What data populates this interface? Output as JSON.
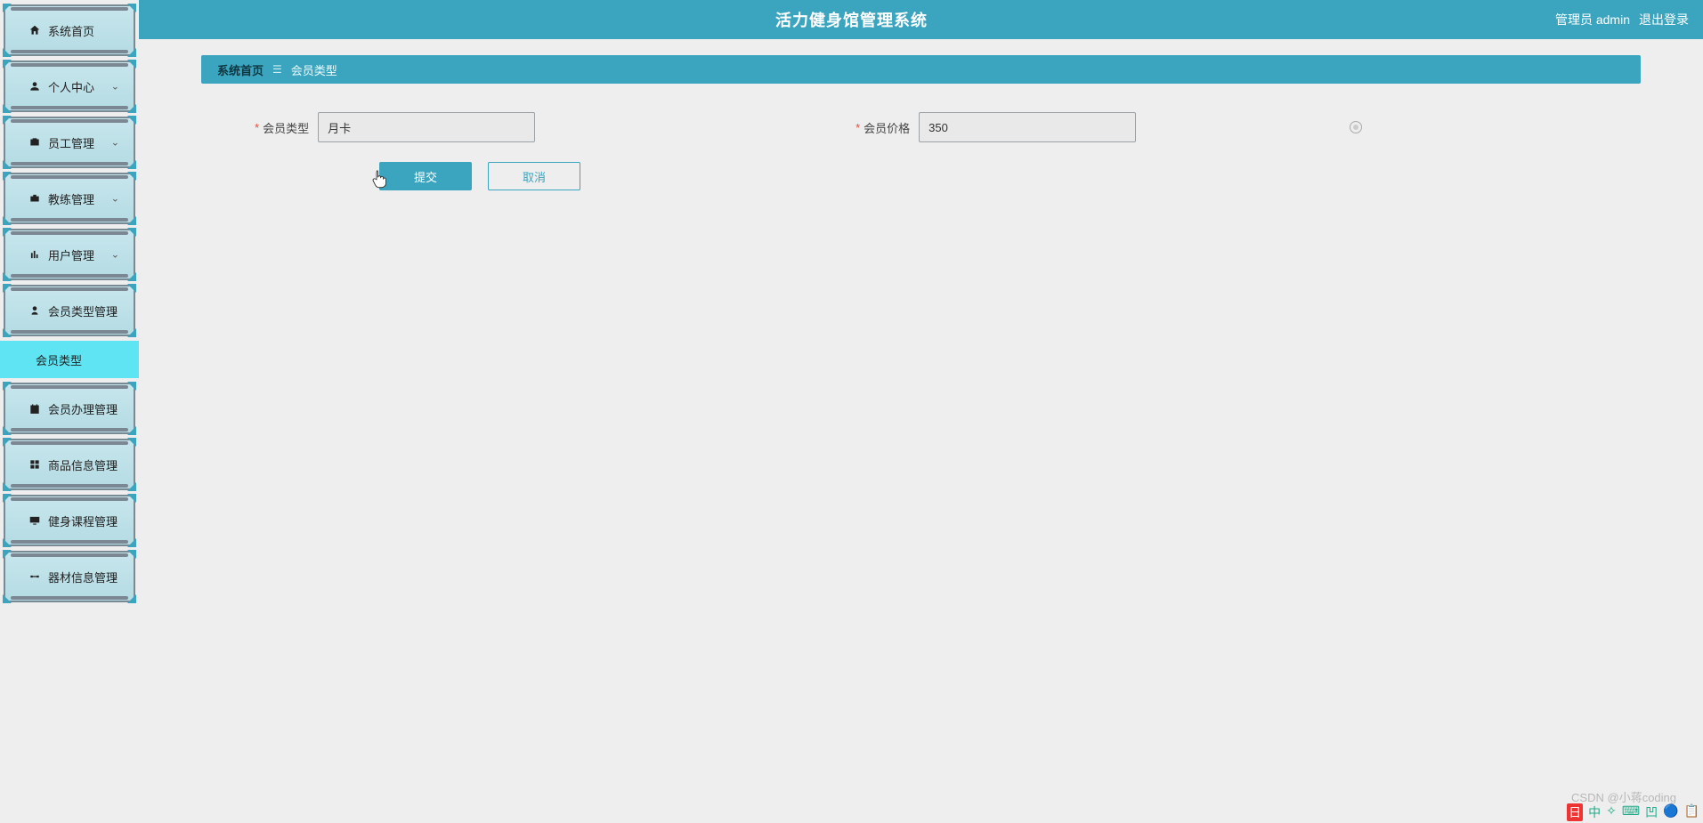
{
  "header": {
    "title": "活力健身馆管理系统",
    "admin_label": "管理员 admin",
    "logout_label": "退出登录"
  },
  "sidebar": {
    "items": [
      {
        "label": "系统首页",
        "icon": "home-icon",
        "expandable": false
      },
      {
        "label": "个人中心",
        "icon": "user-icon",
        "expandable": true
      },
      {
        "label": "员工管理",
        "icon": "badge-icon",
        "expandable": true
      },
      {
        "label": "教练管理",
        "icon": "briefcase-icon",
        "expandable": true
      },
      {
        "label": "用户管理",
        "icon": "chart-icon",
        "expandable": true
      },
      {
        "label": "会员类型管理",
        "icon": "member-icon",
        "expandable": true,
        "expanded": true
      },
      {
        "label": "会员办理管理",
        "icon": "clipboard-icon",
        "expandable": true
      },
      {
        "label": "商品信息管理",
        "icon": "grid-icon",
        "expandable": true
      },
      {
        "label": "健身课程管理",
        "icon": "monitor-icon",
        "expandable": true
      },
      {
        "label": "器材信息管理",
        "icon": "equipment-icon",
        "expandable": true
      }
    ],
    "sub_item_label": "会员类型"
  },
  "breadcrumb": {
    "home": "系统首页",
    "sep": "☰",
    "current": "会员类型"
  },
  "form": {
    "member_type": {
      "label": "会员类型",
      "value": "月卡"
    },
    "member_price": {
      "label": "会员价格",
      "value": "350"
    },
    "submit_label": "提交",
    "cancel_label": "取消"
  },
  "watermark": "CSDN @小蒋coding",
  "tray": [
    "日",
    "中",
    "✧",
    "⌨",
    "凹",
    "🔵",
    "📋"
  ]
}
